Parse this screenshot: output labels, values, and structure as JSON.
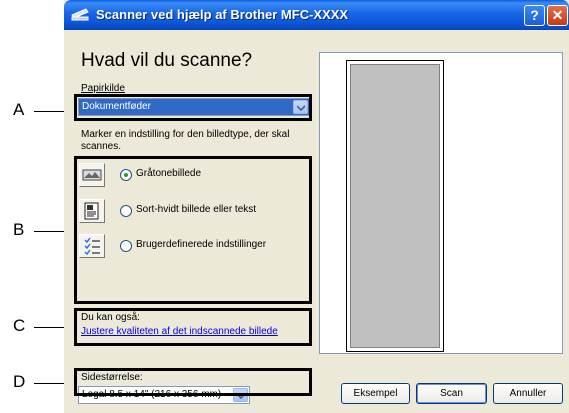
{
  "callouts": [
    {
      "letter": "A"
    },
    {
      "letter": "B"
    },
    {
      "letter": "C"
    },
    {
      "letter": "D"
    }
  ],
  "window": {
    "title": "Scanner ved hjælp af Brother MFC-XXXX",
    "help_label": "?",
    "close_label": "✕"
  },
  "heading": "Hvad vil du scanne?",
  "paper_source": {
    "label": "Papirkilde",
    "selected": "Dokumentføder"
  },
  "image_type": {
    "description": "Marker en indstilling for den billedtype, der skal scannes.",
    "options": [
      {
        "label": "Gråtonebillede",
        "icon": "grayscale-photo-icon",
        "selected": true
      },
      {
        "label": "Sort-hvidt billede eller tekst",
        "icon": "bw-text-icon",
        "selected": false
      },
      {
        "label": "Brugerdefinerede indstillinger",
        "icon": "custom-settings-icon",
        "selected": false
      }
    ]
  },
  "also": {
    "label": "Du kan også:",
    "link": "Justere kvaliteten af det indscannede billede"
  },
  "page_size": {
    "label": "Sidestørrelse:",
    "selected": "Legal 8.5 x 14\" (216 x 356 mm)"
  },
  "buttons": {
    "preview": "Eksempel",
    "scan": "Scan",
    "cancel": "Annuller"
  }
}
